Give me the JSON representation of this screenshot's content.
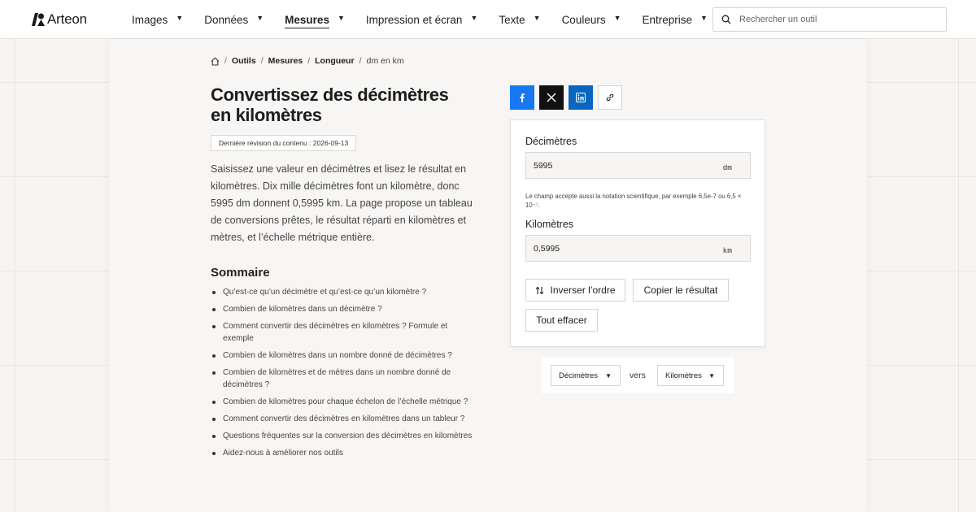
{
  "brand": {
    "name": "Arteon"
  },
  "nav": {
    "items": [
      {
        "label": "Images",
        "active": false
      },
      {
        "label": "Données",
        "active": false
      },
      {
        "label": "Mesures",
        "active": true
      },
      {
        "label": "Impression et écran",
        "active": false
      },
      {
        "label": "Texte",
        "active": false
      },
      {
        "label": "Couleurs",
        "active": false
      },
      {
        "label": "Entreprise",
        "active": false
      }
    ],
    "caret": "▼"
  },
  "search": {
    "placeholder": "Rechercher un outil"
  },
  "breadcrumb": {
    "items": [
      "Outils",
      "Mesures",
      "Longueur"
    ],
    "current": "dm en km",
    "separator": "/"
  },
  "page": {
    "title": "Convertissez des décimètres en kilomètres",
    "revision": "Dernière révision du contenu : 2026-09-13",
    "intro": "Saisissez une valeur en décimètres et lisez le résultat en kilomètres. Dix mille décimètres font un kilomètre, donc 5995 dm donnent 0,5995 km. La page propose un tableau de conversions prêtes, le résultat réparti en kilomètres et mètres, et l’échelle métrique entière."
  },
  "toc": {
    "title": "Sommaire",
    "items": [
      "Qu’est-ce qu’un décimètre et qu’est-ce qu’un kilomètre ?",
      "Combien de kilomètres dans un décimètre ?",
      "Comment convertir des décimètres en kilomètres ? Formule et exemple",
      "Combien de kilomètres dans un nombre donné de décimètres ?",
      "Combien de kilomètres et de mètres dans un nombre donné de décimètres ?",
      "Combien de kilomètres pour chaque échelon de l’échelle métrique ?",
      "Comment convertir des décimètres en kilomètres dans un tableur ?",
      "Questions fréquentes sur la conversion des décimètres en kilomètres",
      "Aidez-nous à améliorer nos outils"
    ]
  },
  "share": {
    "facebook_color": "#1877f2",
    "x_color": "#111111",
    "linkedin_color": "#0a66c2"
  },
  "converter": {
    "from": {
      "label": "Décimètres",
      "value": "5995",
      "unit": "dm"
    },
    "hint": "Le champ accepte aussi la notation scientifique, par exemple 6,5e-7 ou 6,5 × 10⁻⁷.",
    "to": {
      "label": "Kilomètres",
      "value": "0,5995",
      "unit": "km"
    },
    "buttons": {
      "swap": "Inverser l’ordre",
      "copy": "Copier le résultat",
      "clear": "Tout effacer"
    }
  },
  "unit_selector": {
    "from": "Décimètres",
    "to": "Kilomètres",
    "connector": "vers",
    "caret": "▼"
  }
}
